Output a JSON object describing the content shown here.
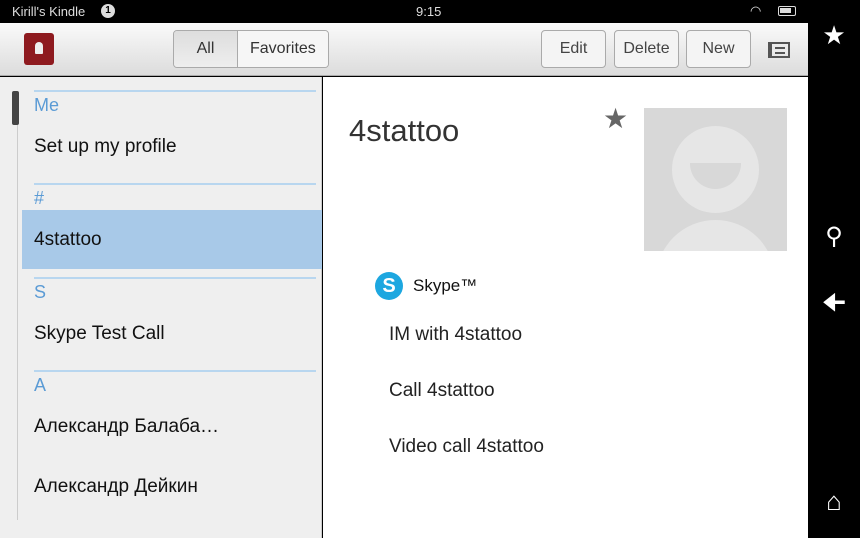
{
  "status": {
    "device": "Kirill's Kindle",
    "notifications": "1",
    "time": "9:15"
  },
  "toolbar": {
    "tabs": [
      "All",
      "Favorites"
    ],
    "edit": "Edit",
    "delete": "Delete",
    "new": "New"
  },
  "list": {
    "sections": [
      {
        "header": "Me",
        "items": [
          "Set up my profile"
        ]
      },
      {
        "header": "#",
        "items": [
          "4stattoo"
        ]
      },
      {
        "header": "S",
        "items": [
          "Skype Test Call"
        ]
      },
      {
        "header": "A",
        "items": [
          "Александр Балаба…",
          "Александр Дейкин"
        ]
      }
    ]
  },
  "detail": {
    "name": "4stattoo",
    "service": "Skype™",
    "actions": [
      "IM with 4stattoo",
      "Call 4stattoo",
      "Video call 4stattoo"
    ]
  },
  "colors": {
    "accent": "#5b9bd5",
    "selected": "#a8c9e8",
    "skype": "#1da7e0"
  }
}
